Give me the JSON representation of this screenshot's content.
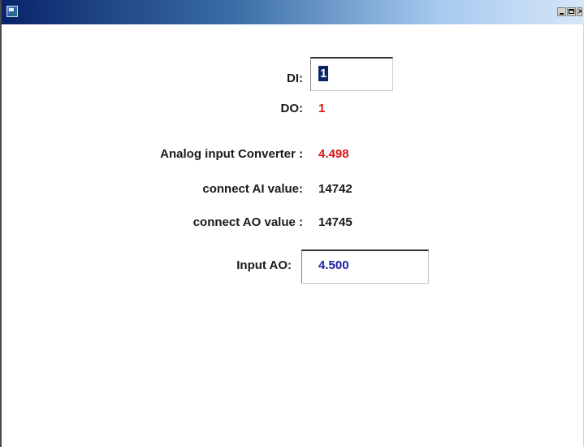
{
  "window": {
    "title_buttons": {
      "minimize": "_",
      "maximize": "□",
      "close": "×"
    }
  },
  "form": {
    "di": {
      "label": "DI:",
      "value": "1"
    },
    "do": {
      "label": "DO:",
      "value": "1"
    },
    "analog_input": {
      "label": "Analog input Converter :",
      "value": "4.498"
    },
    "connect_ai": {
      "label": "connect AI value:",
      "value": "14742"
    },
    "connect_ao": {
      "label": "connect AO value :",
      "value": "14745"
    },
    "input_ao": {
      "label": "Input AO:",
      "value": "4.500"
    }
  },
  "colors": {
    "title_gradient_start": "#0a246a",
    "value_red": "#e01010",
    "value_blue": "#1c1ca8",
    "selection": "#0a246a"
  }
}
